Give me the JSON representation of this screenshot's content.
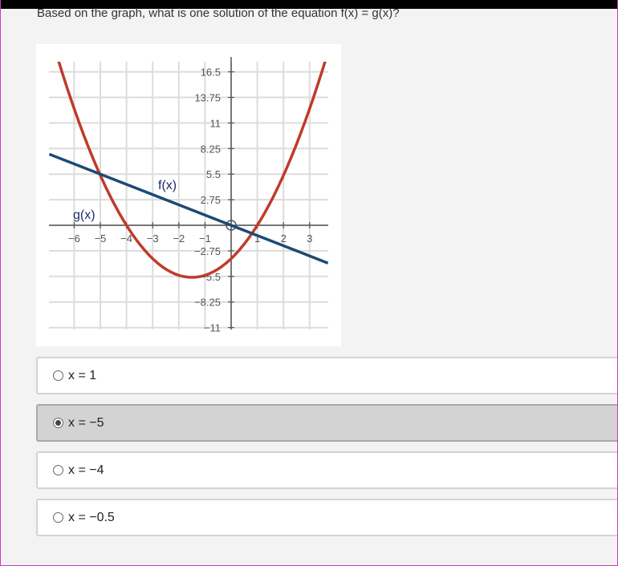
{
  "question": "Based on the graph, what is one solution of the equation f(x) = g(x)?",
  "graph": {
    "x_ticks": [
      "−6",
      "−5",
      "−4",
      "−3",
      "−2",
      "−1",
      "1",
      "2",
      "3"
    ],
    "y_ticks": [
      "16.5",
      "13.75",
      "11",
      "8.25",
      "5.5",
      "2.75",
      "−2.75",
      "−5.5",
      "−8.25",
      "−11"
    ],
    "f_label": "f(x)",
    "g_label": "g(x)",
    "f_color": "#1d4a74",
    "g_color": "#bf3b2b"
  },
  "chart_data": {
    "type": "line",
    "x_range": [
      -6.5,
      3.5
    ],
    "y_range": [
      -11,
      17
    ],
    "grid": true,
    "series": [
      {
        "name": "f(x)",
        "kind": "linear",
        "slope": -1.1,
        "intercept": 0
      },
      {
        "name": "g(x)",
        "kind": "quadratic",
        "roots": [
          -4,
          1
        ],
        "vertex": [
          -1.5,
          -5.6
        ]
      }
    ],
    "intersections": [
      [
        -5,
        5.5
      ],
      [
        0.5,
        -0.55
      ]
    ]
  },
  "choices": [
    {
      "label": "x = 1",
      "selected": false
    },
    {
      "label": "x = −5",
      "selected": true
    },
    {
      "label": "x = −4",
      "selected": false
    },
    {
      "label": "x = −0.5",
      "selected": false
    }
  ]
}
